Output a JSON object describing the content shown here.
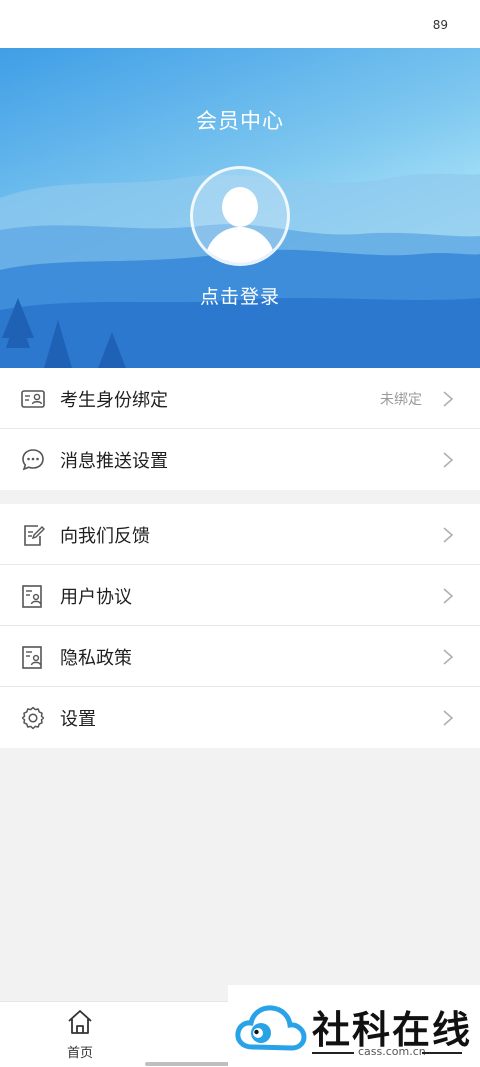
{
  "status_bar": {
    "battery": "89"
  },
  "header": {
    "title": "会员中心",
    "login_label": "点击登录"
  },
  "menu_group_1": [
    {
      "label": "考生身份绑定",
      "extra": "未绑定",
      "icon": "id-card-icon"
    },
    {
      "label": "消息推送设置",
      "icon": "chat-bubble-icon"
    }
  ],
  "menu_group_2": [
    {
      "label": "向我们反馈",
      "icon": "edit-document-icon"
    },
    {
      "label": "用户协议",
      "icon": "document-user-icon"
    },
    {
      "label": "隐私政策",
      "icon": "document-user-icon"
    },
    {
      "label": "设置",
      "icon": "gear-icon"
    }
  ],
  "tabbar": {
    "home_label": "首页"
  },
  "watermark": {
    "brand": "社科在线",
    "url": "cass.com.cn"
  },
  "colors": {
    "sky_top": "#3f9ee6",
    "sky_bottom": "#d8f6ff",
    "watermark_blue": "#29a3e8"
  }
}
